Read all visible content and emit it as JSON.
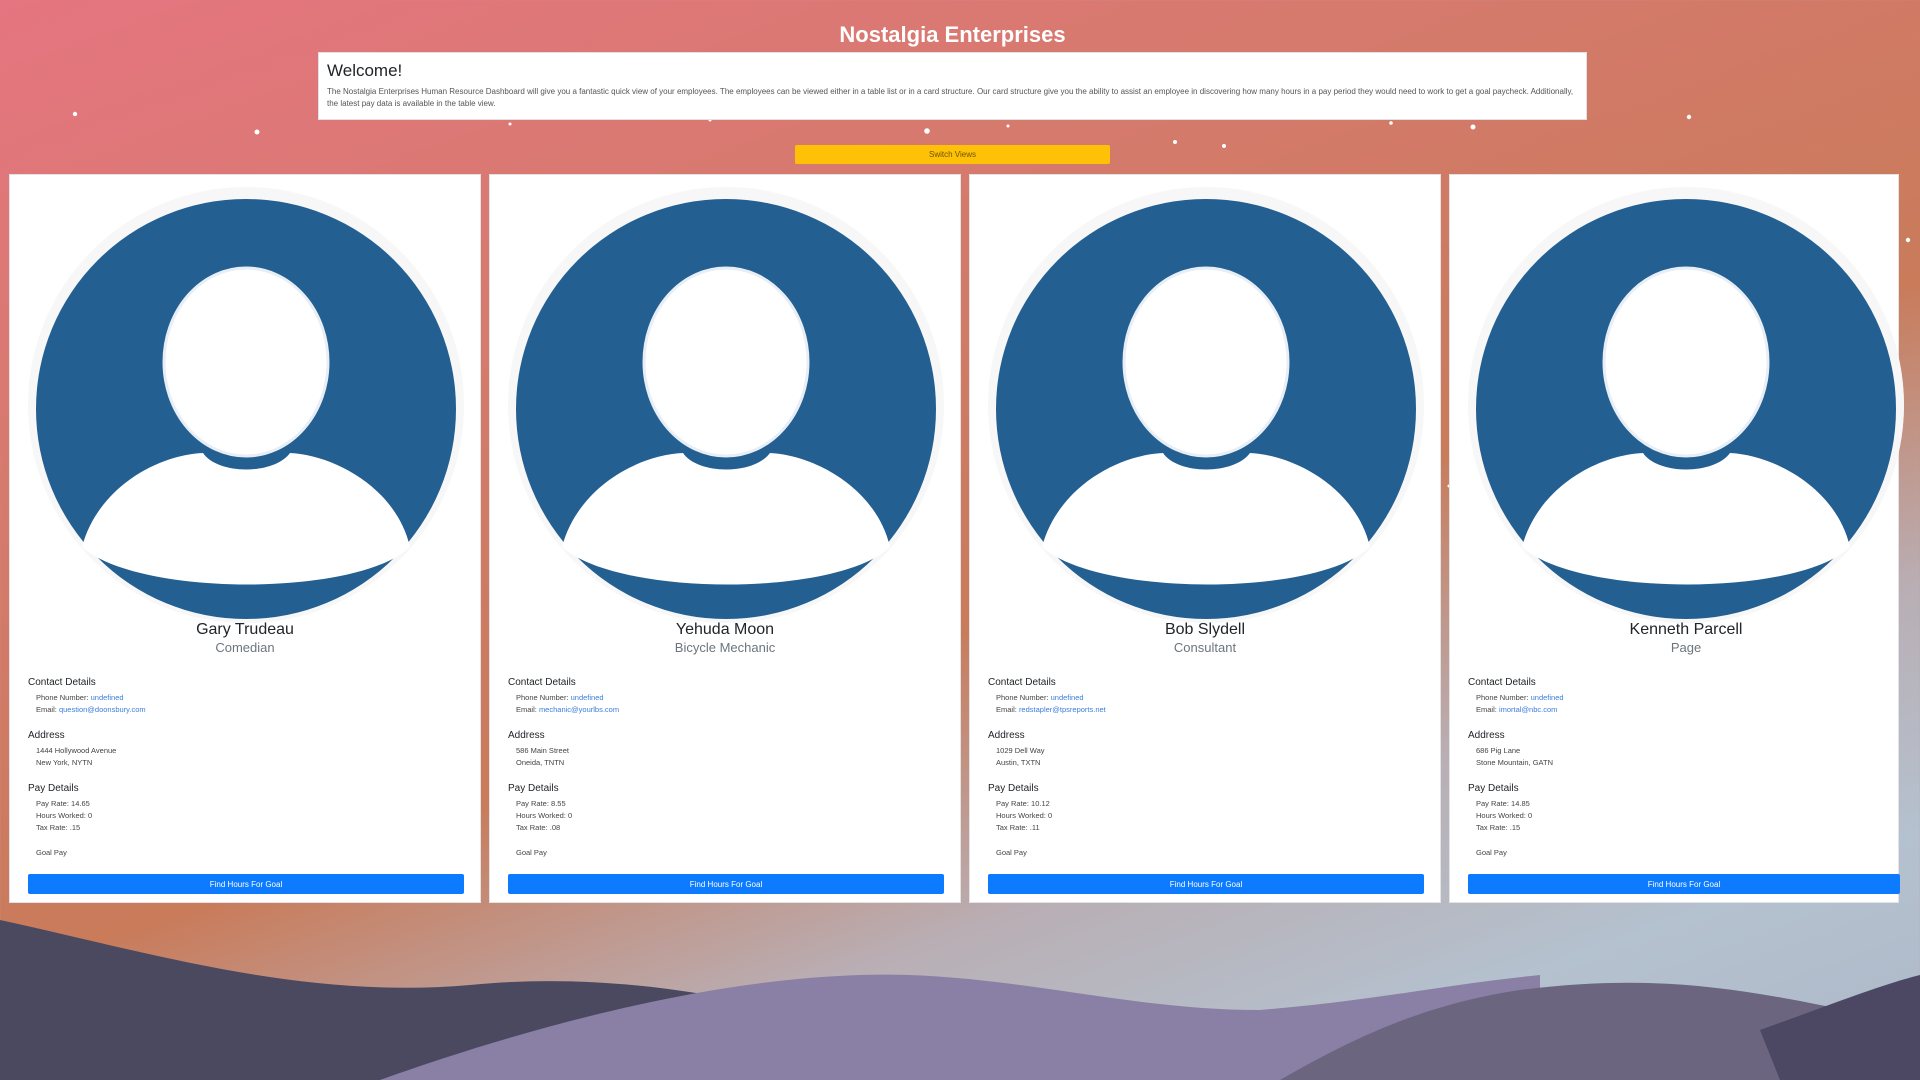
{
  "page": {
    "title": "Nostalgia Enterprises",
    "accent_color": "#0d7bff",
    "switch_button_color": "#ffc107"
  },
  "welcome": {
    "heading": "Welcome!",
    "body": "The Nostalgia Enterprises Human Resource Dashboard will give you a fantastic quick view of your employees. The employees can be viewed either in a table list or in a card structure. Our card structure give you the ability to assist an employee in discovering how many hours in a pay period they would need to work to get a goal paycheck. Additionally, the latest pay data is available in the table view."
  },
  "switch_views_label": "Switch Views",
  "card_labels": {
    "contact": "Contact Details",
    "phone": "Phone Number:",
    "email": "Email:",
    "address": "Address",
    "pay": "Pay Details",
    "pay_rate": "Pay Rate:",
    "hours": "Hours Worked:",
    "tax": "Tax Rate:",
    "goal_pay": "Goal Pay",
    "goal_button": "Find Hours For Goal",
    "avatar_icon": "default-user-avatar-icon"
  },
  "employees": [
    {
      "name": "Gary Trudeau",
      "title": "Comedian",
      "phone": "undefined",
      "email": "question@doonsbury.com",
      "street": "1444 Hollywood Avenue",
      "city": "New York, NYTN",
      "pay_rate": "14.65",
      "hours_worked": "0",
      "tax_rate": ".15"
    },
    {
      "name": "Yehuda Moon",
      "title": "Bicycle Mechanic",
      "phone": "undefined",
      "email": "mechanic@yourlbs.com",
      "street": "586 Main Street",
      "city": "Oneida, TNTN",
      "pay_rate": "8.55",
      "hours_worked": "0",
      "tax_rate": ".08"
    },
    {
      "name": "Bob Slydell",
      "title": "Consultant",
      "phone": "undefined",
      "email": "redstapler@tpsreports.net",
      "street": "1029 Dell Way",
      "city": "Austin, TXTN",
      "pay_rate": "10.12",
      "hours_worked": "0",
      "tax_rate": ".11"
    },
    {
      "name": "Kenneth Parcell",
      "title": "Page",
      "phone": "undefined",
      "email": "imortal@nbc.com",
      "street": "686 Pig Lane",
      "city": "Stone Mountain, GATN",
      "pay_rate": "14.85",
      "hours_worked": "0",
      "tax_rate": ".15"
    }
  ]
}
